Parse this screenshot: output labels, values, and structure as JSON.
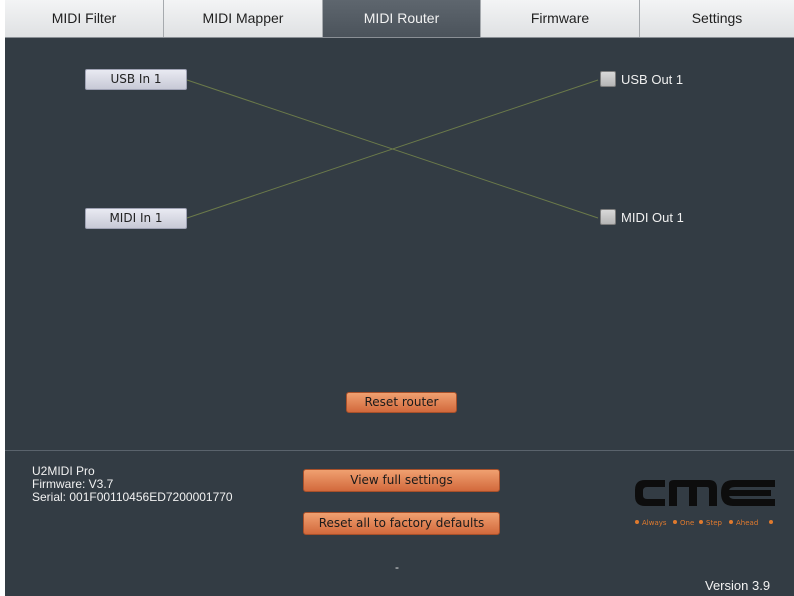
{
  "tabs": [
    {
      "label": "MIDI Filter",
      "active": false
    },
    {
      "label": "MIDI Mapper",
      "active": false
    },
    {
      "label": "MIDI Router",
      "active": true
    },
    {
      "label": "Firmware",
      "active": false
    },
    {
      "label": "Settings",
      "active": false
    }
  ],
  "router": {
    "inputs": [
      "USB In 1",
      "MIDI In 1"
    ],
    "outputs": [
      "USB Out 1",
      "MIDI Out 1"
    ],
    "routes": [
      {
        "from": "USB In 1",
        "to": "MIDI Out 1"
      },
      {
        "from": "MIDI In 1",
        "to": "USB Out 1"
      }
    ],
    "reset_label": "Reset router"
  },
  "device": {
    "name": "U2MIDI Pro",
    "firmware": "Firmware: V3.7",
    "serial": "Serial: 001F00110456ED7200001770"
  },
  "buttons": {
    "view_full_settings": "View full settings",
    "reset_factory": "Reset all to factory defaults"
  },
  "status_text": "-",
  "version": "Version 3.9",
  "logo": {
    "brand": "CME",
    "tagline": [
      "Always",
      "One",
      "Step",
      "Ahead"
    ]
  },
  "colors": {
    "background": "#333c44",
    "route_line": "#6b7a4a",
    "accent_orange": "#d2693c"
  }
}
